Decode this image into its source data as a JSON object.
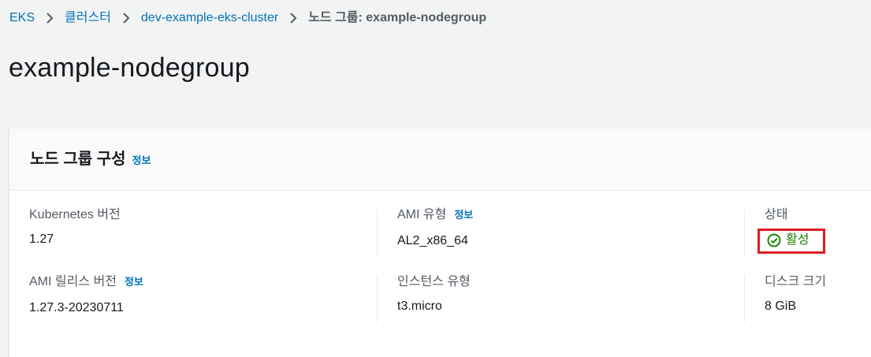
{
  "breadcrumb": {
    "items": [
      {
        "label": "EKS"
      },
      {
        "label": "클러스터"
      },
      {
        "label": "dev-example-eks-cluster"
      }
    ],
    "current": "노드 그룹: example-nodegroup"
  },
  "page": {
    "title": "example-nodegroup"
  },
  "config_card": {
    "title": "노드 그룹 구성",
    "info_label": "정보",
    "fields": {
      "kubernetes_version": {
        "label": "Kubernetes 버전",
        "value": "1.27"
      },
      "ami_type": {
        "label": "AMI 유형",
        "info_label": "정보",
        "value": "AL2_x86_64"
      },
      "status": {
        "label": "상태",
        "value": "활성",
        "color": "#1d8102",
        "icon": "check-circle-icon"
      },
      "ami_release_version": {
        "label": "AMI 릴리스 버전",
        "info_label": "정보",
        "value": "1.27.3-20230711"
      },
      "instance_type": {
        "label": "인스턴스 유형",
        "value": "t3.micro"
      },
      "disk_size": {
        "label": "디스크 크기",
        "value": "8 GiB"
      }
    }
  },
  "colors": {
    "link": "#0073bb",
    "highlight_box": "#e01b24",
    "background": "#f2f3f3"
  }
}
